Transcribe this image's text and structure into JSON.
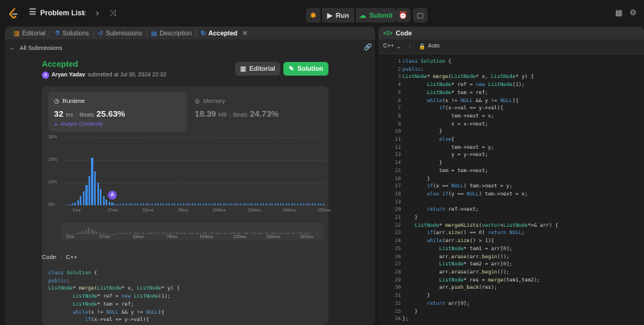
{
  "topbar": {
    "problem_list": "Problem List",
    "run": "Run",
    "submit": "Submit"
  },
  "left_tabs": [
    {
      "label": "Editorial",
      "icon": "book-icon"
    },
    {
      "label": "Solutions",
      "icon": "flask-icon"
    },
    {
      "label": "Submissions",
      "icon": "history-icon"
    },
    {
      "label": "Description",
      "icon": "document-icon"
    },
    {
      "label": "Accepted",
      "icon": "refresh-icon"
    }
  ],
  "submission": {
    "back": "All Submissions",
    "status": "Accepted",
    "user": "Aryan Yadav",
    "submitted": "submitted at Jul 30, 2024 22:32",
    "editorial_btn": "Editorial",
    "solution_btn": "Solution",
    "runtime_label": "Runtime",
    "runtime_value": "32",
    "runtime_unit": "ms",
    "beats_label": "Beats",
    "runtime_beats": "25.63%",
    "analyze": "Analyze Complexity",
    "memory_label": "Memory",
    "memory_value": "18.39",
    "memory_unit": "MB",
    "memory_beats": "24.73%",
    "avatar_letter": "A",
    "code_label": "Code",
    "code_lang": "C++"
  },
  "chart_data": {
    "type": "bar",
    "yticks": [
      "30%",
      "20%",
      "10%",
      "0%"
    ],
    "xticks": [
      "1ms",
      "27ms",
      "53ms",
      "78ms",
      "104ms",
      "130ms",
      "156ms",
      "182ms"
    ],
    "overview_ticks": [
      "1ms",
      "27ms",
      "53ms",
      "78ms",
      "104ms",
      "130ms",
      "156ms",
      "182ms"
    ],
    "ylim": [
      0,
      30
    ],
    "values": [
      0.3,
      0.6,
      1.2,
      2,
      4,
      6,
      9,
      13,
      21,
      15,
      10,
      7,
      4,
      2.5,
      1.5,
      1,
      0.5,
      0.4,
      0.3
    ],
    "marker_label": "A"
  },
  "code_panel": {
    "title": "Code",
    "lang": "C++",
    "mode": "Auto"
  },
  "code_lines": [
    "class Solution {",
    "public:",
    "ListNode* merge(ListNode* x, ListNode* y) {",
    "        ListNode* ref = new ListNode(1);",
    "        ListNode* tem = ref;",
    "        while(x != NULL && y != NULL){",
    "            if(x->val <= y->val){",
    "                tem->next = x;",
    "                x = x->next;",
    "            }",
    "            else{",
    "                tem->next = y;",
    "                y = y->next;",
    "            }",
    "            tem = tem->next;",
    "        }",
    "        if(x == NULL) tem->next = y;",
    "        else if(y == NULL) tem->next = x;",
    "",
    "        return ref->next;",
    "    }",
    "    ListNode* mergeKLists(vector<ListNode*>& arr) {",
    "        if(arr.size() == 0) return NULL;",
    "        while(arr.size() > 1){",
    "            ListNode* tem1 = arr[0];",
    "            arr.erase(arr.begin());",
    "            ListNode* tem2 = arr[0];",
    "            arr.erase(arr.begin());",
    "            ListNode* res = merge(tem1,tem2);",
    "            arr.push_back(res);",
    "        }",
    "        return arr[0];",
    "    }",
    "};"
  ],
  "preview_lines": [
    "class Solution {",
    "public:",
    "ListNode* merge(ListNode* x, ListNode* y) {",
    "        ListNode* ref = new ListNode(1);",
    "        ListNode* tem = ref;",
    "        while(x != NULL && y != NULL){",
    "            if(x->val <= y->val){"
  ]
}
